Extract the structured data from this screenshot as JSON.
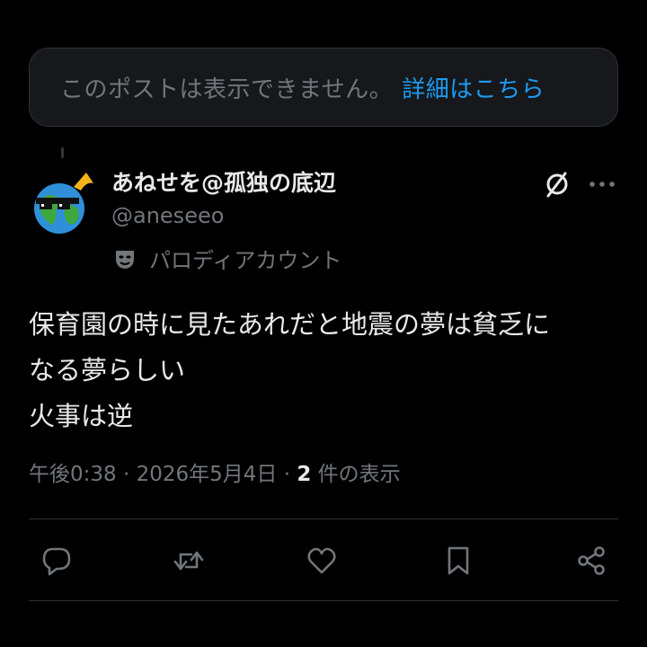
{
  "notice": {
    "text": "このポストは表示できません。",
    "link_label": "詳細はこちら"
  },
  "author": {
    "display_name": "あねせを@孤独の底辺",
    "handle": "@aneseeo",
    "parody_label": "パロディアカウント"
  },
  "post": {
    "lines": [
      "保育園の時に見たあれだと地震の夢は貧乏に",
      "なる夢らしい",
      "火事は逆"
    ]
  },
  "meta": {
    "time": "午後0:38",
    "separator": " · ",
    "date": "2026年5月4日",
    "views_count": "2",
    "views_label": " 件の表示"
  },
  "actions": {
    "reply": "reply-icon",
    "repost": "repost-icon",
    "like": "heart-icon",
    "bookmark": "bookmark-icon",
    "share": "share-icon"
  },
  "colors": {
    "background": "#000000",
    "text_primary": "#e7e9ea",
    "text_secondary": "#71767b",
    "link": "#1d9bf0",
    "border": "#2f3336",
    "notice_bg": "#16181c"
  }
}
